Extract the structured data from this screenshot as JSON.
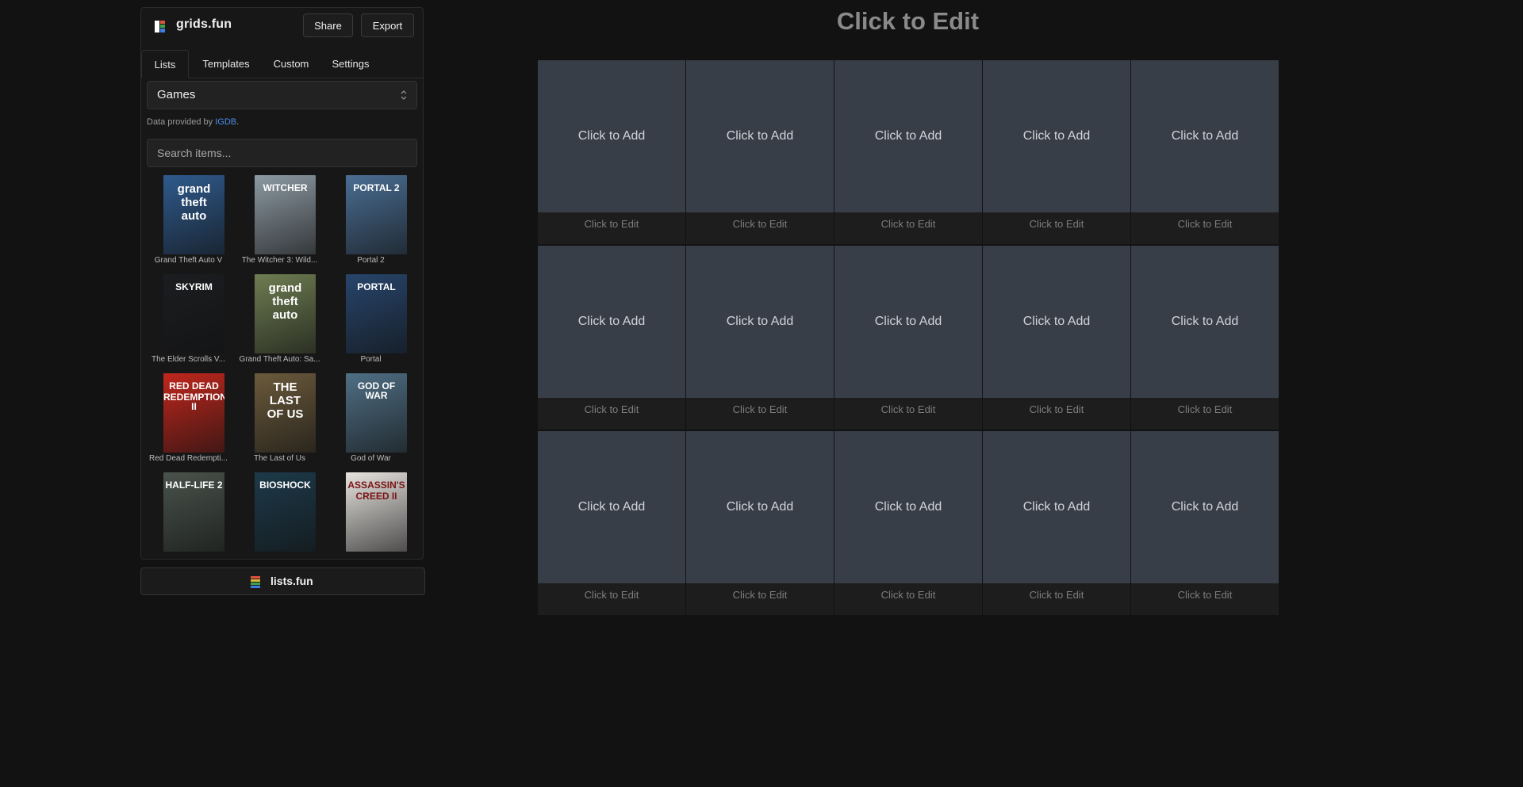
{
  "app": {
    "name": "grids.fun",
    "share_label": "Share",
    "export_label": "Export"
  },
  "tabs": [
    {
      "label": "Lists",
      "active": true
    },
    {
      "label": "Templates",
      "active": false
    },
    {
      "label": "Custom",
      "active": false
    },
    {
      "label": "Settings",
      "active": false
    }
  ],
  "list_select": {
    "value": "Games"
  },
  "credit": {
    "prefix": "Data provided by ",
    "link": "IGDB",
    "suffix": "."
  },
  "search": {
    "placeholder": "Search items..."
  },
  "items": [
    {
      "label": "Grand Theft Auto V",
      "cover_text": [
        "grand",
        "theft",
        "auto"
      ],
      "cover_color": "#2f5a8c"
    },
    {
      "label": "The Witcher 3: Wild...",
      "cover_text": [
        "WITCHER"
      ],
      "cover_color": "#8d9aa3"
    },
    {
      "label": "Portal 2",
      "cover_text": [
        "PORTAL 2"
      ],
      "cover_color": "#4a6e93"
    },
    {
      "label": "The Elder Scrolls V...",
      "cover_text": [
        "SKYRIM"
      ],
      "cover_color": "#1b1d20"
    },
    {
      "label": "Grand Theft Auto: Sa...",
      "cover_text": [
        "grand",
        "theft",
        "auto"
      ],
      "cover_color": "#6e7d52"
    },
    {
      "label": "Portal",
      "cover_text": [
        "PORTAL"
      ],
      "cover_color": "#27456b"
    },
    {
      "label": "Red Dead Redempti...",
      "cover_text": [
        "RED DEAD",
        "REDEMPTION II"
      ],
      "cover_color": "#c0271d"
    },
    {
      "label": "The Last of Us",
      "cover_text": [
        "THE",
        "LAST",
        "OF US"
      ],
      "cover_color": "#6b5a3c"
    },
    {
      "label": "God of War",
      "cover_text": [
        "GOD OF WAR"
      ],
      "cover_color": "#4f6f84"
    },
    {
      "label": "",
      "cover_text": [
        "HALF-LIFE 2"
      ],
      "cover_color": "#49534c"
    },
    {
      "label": "",
      "cover_text": [
        "BIOSHOCK"
      ],
      "cover_color": "#1d3a4a"
    },
    {
      "label": "",
      "cover_text": [
        "ASSASSIN'S",
        "CREED II"
      ],
      "cover_color": "#e7e4e0"
    }
  ],
  "footer": {
    "label": "lists.fun"
  },
  "grid": {
    "title": "Click to Edit",
    "columns": 5,
    "rows": 3,
    "cell_add_label": "Click to Add",
    "cell_caption_label": "Click to Edit"
  },
  "colors": {
    "background": "#121212",
    "cell": "#383e47",
    "link": "#4c8fe8"
  }
}
